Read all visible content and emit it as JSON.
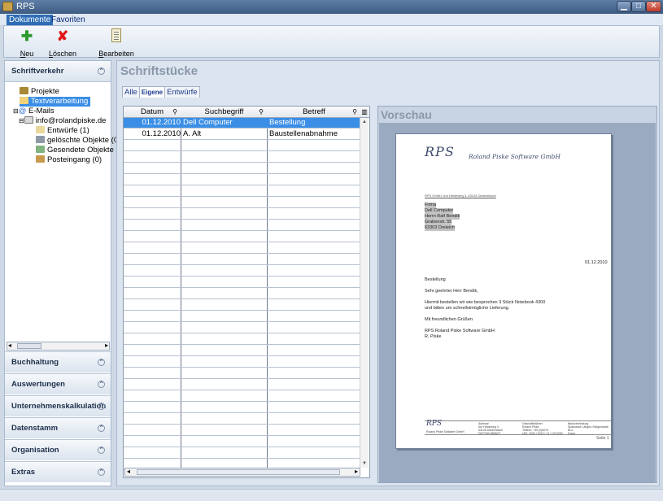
{
  "window": {
    "title": "RPS"
  },
  "ribbon": {
    "tabs": [
      {
        "label": "Dokumente",
        "active": true
      },
      {
        "label": "Favoriten",
        "active": false
      }
    ],
    "buttons": [
      {
        "label": "Neu",
        "icon": "add-icon"
      },
      {
        "label": "Löschen",
        "icon": "delete-icon"
      },
      {
        "label": "Bearbeiten",
        "icon": "edit-document-icon"
      }
    ]
  },
  "sidebar": {
    "header": "Schriftverkehr",
    "tree": [
      {
        "label": "Projekte"
      },
      {
        "label": "Textverarbeitung",
        "selected": true
      },
      {
        "label": "E-Mails"
      },
      {
        "label": "info@rolandpiske.de"
      },
      {
        "label": "Entwürfe (1)"
      },
      {
        "label": "gelöschte Objekte (0)"
      },
      {
        "label": "Gesendete Objekte ("
      },
      {
        "label": "Posteingang (0)"
      }
    ],
    "sections": [
      {
        "label": "Buchhaltung"
      },
      {
        "label": "Auswertungen"
      },
      {
        "label": "Unternehmenskalkulation"
      },
      {
        "label": "Datenstamm"
      },
      {
        "label": "Organisation"
      },
      {
        "label": "Extras"
      }
    ]
  },
  "main": {
    "title": "Schriftstücke",
    "subtabs": [
      {
        "label": "Alle"
      },
      {
        "label": "Eigene",
        "active": true
      },
      {
        "label": "Entwürfe"
      }
    ],
    "table": {
      "columns": [
        "Datum",
        "Suchbegriff",
        "Betreff"
      ],
      "rows": [
        {
          "datum": "01.12.2010",
          "suchbegriff": "Dell Computer",
          "betreff": "Bestellung",
          "selected": true
        },
        {
          "datum": "01.12.2010",
          "suchbegriff": "A. Alt",
          "betreff": "Baustellenabnahme"
        }
      ]
    }
  },
  "preview": {
    "title": "Vorschau",
    "letter": {
      "logo": "RPS",
      "logo_subtitle": "Roland Piske Software GmbH",
      "sender_line": "RPS GmbH, Am Heideweg 3, 63128 Dietzenbach",
      "recipient": [
        "Firma",
        "Dell Computer",
        "Herrn Ralf Bendik",
        "Grabenstr. 55",
        "63303 Dreieich"
      ],
      "date": "01.12.2010",
      "subject": "Bestellung",
      "salutation": "Sehr geehrter Herr Bendik,",
      "body1": "Hiermit bestellen wir wie besprochen 3 Stück Notebook 4300",
      "body2": "und bitten um schnellstmögliche Lieferung.",
      "closing": "Mit freundlichen Grüßen",
      "signature1": "RPS Roland Piske Software GmbH",
      "signature2": "R. Piske",
      "footer_logo": "RPS",
      "footer_company": "Roland Piske Software GmbH",
      "footer_col1": [
        "Adresse",
        "Am Heideweg 3",
        "63128 Dietzenbach",
        "DE/THW 8836/07"
      ],
      "footer_col2": [
        "Geschäftsführer",
        "Roland Piske",
        "Telefon: +49 (0)6074",
        "UID: 1000 / 2010 / 11 / 1210230"
      ],
      "footer_col3": [
        "Bankverbindung",
        "Sparkasse Langen-Seligenstadt",
        "BLZ",
        "Konto"
      ],
      "page_label": "Seite 1"
    }
  }
}
